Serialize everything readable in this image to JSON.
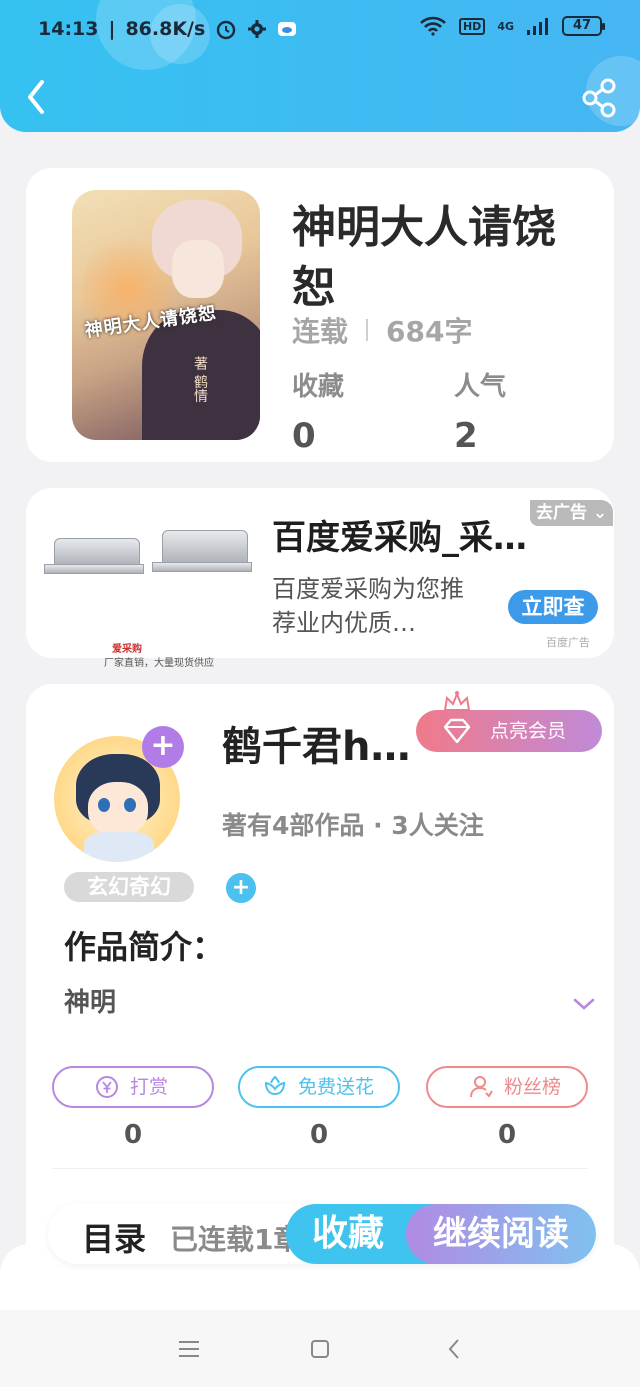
{
  "status_bar": {
    "time": "14:13",
    "speed": "86.8K/s",
    "hd": "HD",
    "network": "4G",
    "battery": "47"
  },
  "header": {
    "back_icon": "chevron-left-icon",
    "share_icon": "share-icon"
  },
  "book": {
    "title": "神明大人请饶恕",
    "cover_text": "神明大人请饶恕",
    "cover_author": "著 鹤情",
    "status": "连载",
    "word_count": "684字",
    "favorites_label": "收藏",
    "favorites_value": "0",
    "popularity_label": "人气",
    "popularity_value": "2"
  },
  "ad": {
    "title": "百度爱采购_采…",
    "description": "百度爱采购为您推荐业内优质…",
    "close_label": "去广告",
    "cta_label": "立即查",
    "mark": "百度广告",
    "image_brand": "爱采购",
    "image_slogan": "厂家直销，大量现货供应"
  },
  "author": {
    "name": "鹤千君h…",
    "vip_label": "点亮会员",
    "meta": "著有4部作品 · 3人关注",
    "follow_icon": "plus-icon"
  },
  "tags": {
    "genre": "玄幻奇幻",
    "add_icon": "plus-icon"
  },
  "intro": {
    "title": "作品简介：",
    "text": "神明"
  },
  "actions": [
    {
      "label": "打赏",
      "count": "0",
      "icon": "yuen-coin-icon",
      "color": "#b887e0"
    },
    {
      "label": "免费送花",
      "count": "0",
      "icon": "flower-icon",
      "color": "#4cc3ee"
    },
    {
      "label": "粉丝榜",
      "count": "0",
      "icon": "user-icon",
      "color": "#ef8a8a"
    }
  ],
  "bottom_bar": {
    "toc_label": "目录",
    "toc_sub": "已连载1章",
    "favorite_label": "收藏",
    "read_label": "继续阅读"
  },
  "colors": {
    "header": "#3dbdf2",
    "accent_blue": "#3fc4f0",
    "accent_purple": "#b18ae3"
  }
}
